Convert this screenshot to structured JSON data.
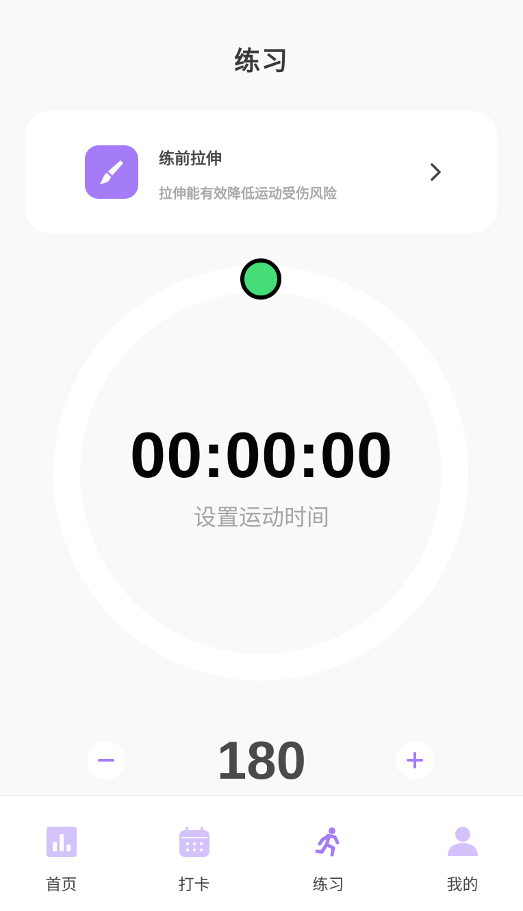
{
  "header": {
    "title": "练习"
  },
  "stretch_card": {
    "title": "练前拉伸",
    "description": "拉伸能有效降低运动受伤风险",
    "icon": "brush-icon"
  },
  "timer": {
    "display": "00:00:00",
    "hint": "设置运动时间"
  },
  "stepper": {
    "value": "180"
  },
  "tabbar": {
    "items": [
      {
        "label": "首页",
        "icon": "bar-chart-icon"
      },
      {
        "label": "打卡",
        "icon": "calendar-icon"
      },
      {
        "label": "练习",
        "icon": "running-icon"
      },
      {
        "label": "我的",
        "icon": "user-icon"
      }
    ],
    "active_index": 2
  },
  "colors": {
    "accent": "#a47cf8",
    "accent_light": "#d4c2fb",
    "handle": "#44dd77",
    "background": "#f9f9f9"
  }
}
